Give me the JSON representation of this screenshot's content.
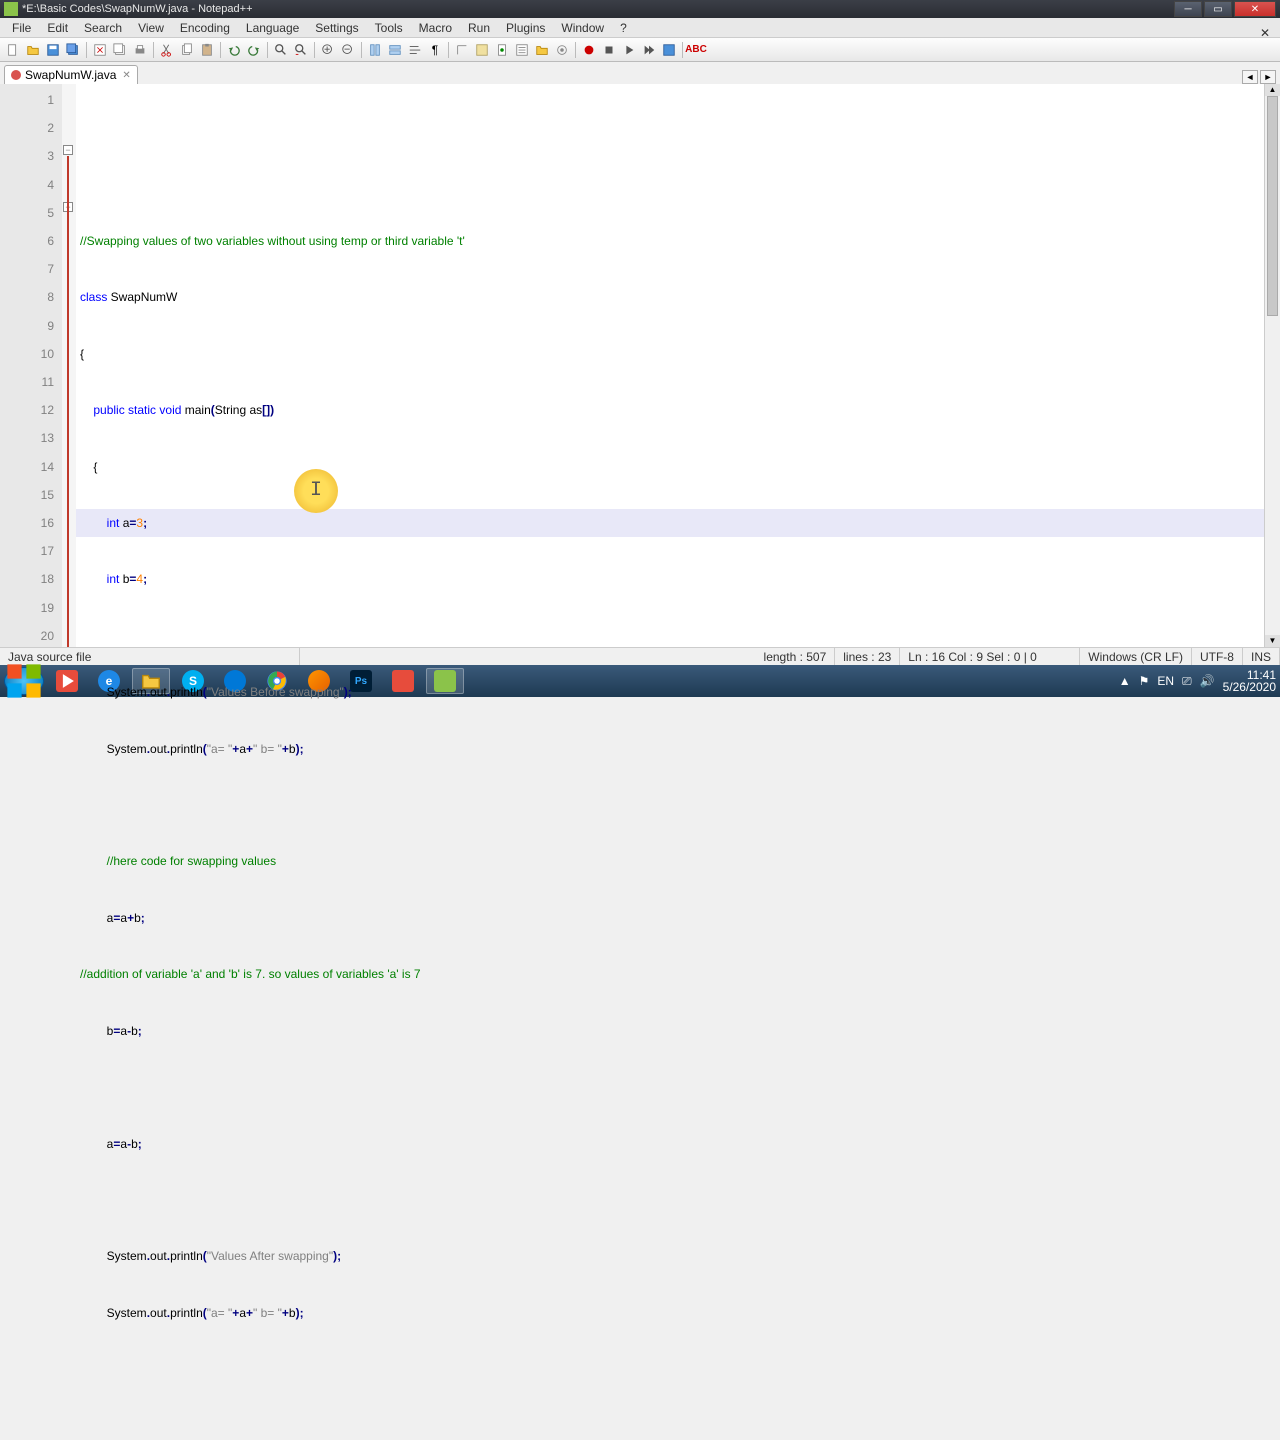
{
  "window": {
    "title": "*E:\\Basic Codes\\SwapNumW.java - Notepad++",
    "min": "_",
    "max": "▢",
    "close": "✕"
  },
  "menu": [
    "File",
    "Edit",
    "Search",
    "View",
    "Encoding",
    "Language",
    "Settings",
    "Tools",
    "Macro",
    "Run",
    "Plugins",
    "Window",
    "?"
  ],
  "tab": {
    "name": "SwapNumW.java",
    "close": "✕"
  },
  "lines": [
    "1",
    "2",
    "3",
    "4",
    "5",
    "6",
    "7",
    "8",
    "9",
    "10",
    "11",
    "12",
    "13",
    "14",
    "15",
    "16",
    "17",
    "18",
    "19",
    "20"
  ],
  "code": {
    "l1_a": "//Swapping values of two variables without using temp or third variable 't'",
    "l2_a": "class",
    "l2_b": " SwapNumW",
    "l3": "{",
    "l4_a": "    ",
    "l4_b": "public",
    "l4_c": " ",
    "l4_d": "static",
    "l4_e": " ",
    "l4_f": "void",
    "l4_g": " main",
    "l4_h": "(",
    "l4_i": "String as",
    "l4_j": "[])",
    "l5": "    {",
    "l6_a": "        ",
    "l6_b": "int",
    "l6_c": " a",
    "l6_d": "=",
    "l6_e": "3",
    "l6_f": ";",
    "l7_a": "        ",
    "l7_b": "int",
    "l7_c": " b",
    "l7_d": "=",
    "l7_e": "4",
    "l7_f": ";",
    "l8": "",
    "l9_a": "        System",
    "l9_b": ".",
    "l9_c": "out",
    "l9_d": ".",
    "l9_e": "println",
    "l9_f": "(",
    "l9_g": "\"Values Before swapping\"",
    "l9_h": ");",
    "l10_a": "        System",
    "l10_b": ".",
    "l10_c": "out",
    "l10_d": ".",
    "l10_e": "println",
    "l10_f": "(",
    "l10_g": "\"a= \"",
    "l10_h": "+",
    "l10_i": "a",
    "l10_j": "+",
    "l10_k": "\" b= \"",
    "l10_l": "+",
    "l10_m": "b",
    "l10_n": ");",
    "l11": "",
    "l12": "        //here code for swapping values",
    "l13_a": "        a",
    "l13_b": "=",
    "l13_c": "a",
    "l13_d": "+",
    "l13_e": "b",
    "l13_f": ";",
    "l14": "//addition of variable 'a' and 'b' is 7. so values of variables 'a' is 7",
    "l15_a": "        b",
    "l15_b": "=",
    "l15_c": "a",
    "l15_d": "-",
    "l15_e": "b",
    "l15_f": ";",
    "l16": "",
    "l17_a": "        a",
    "l17_b": "=",
    "l17_c": "a",
    "l17_d": "-",
    "l17_e": "b",
    "l17_f": ";",
    "l18": "",
    "l19_a": "        System",
    "l19_b": ".",
    "l19_c": "out",
    "l19_d": ".",
    "l19_e": "println",
    "l19_f": "(",
    "l19_g": "\"Values After swapping\"",
    "l19_h": ");",
    "l20_a": "        System",
    "l20_b": ".",
    "l20_c": "out",
    "l20_d": ".",
    "l20_e": "println",
    "l20_f": "(",
    "l20_g": "\"a= \"",
    "l20_h": "+",
    "l20_i": "a",
    "l20_j": "+",
    "l20_k": "\" b= \"",
    "l20_l": "+",
    "l20_m": "b",
    "l20_n": ");"
  },
  "status": {
    "filetype": "Java source file",
    "length": "length : 507",
    "lines": "lines : 23",
    "pos": "Ln : 16    Col : 9    Sel : 0 | 0",
    "eol": "Windows (CR LF)",
    "enc": "UTF-8",
    "mode": "INS"
  },
  "tray": {
    "lang": "EN",
    "time": "11:41",
    "date": "5/26/2020"
  },
  "highlight_char": "I"
}
